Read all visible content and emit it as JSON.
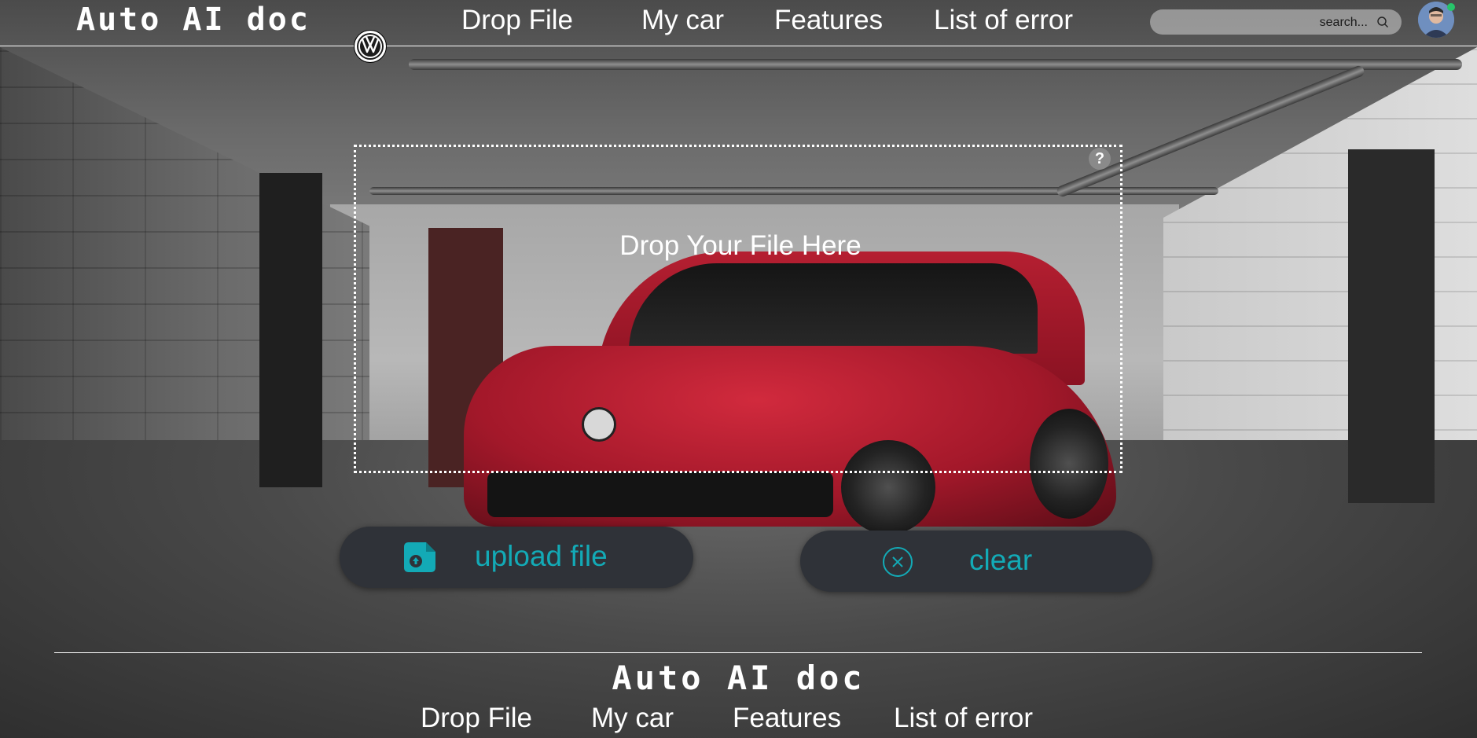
{
  "header": {
    "logo": "Auto AI doc",
    "nav": [
      "Drop File",
      "My car",
      "Features",
      "List of error"
    ],
    "search": {
      "placeholder": "search..."
    }
  },
  "dropzone": {
    "title": "Drop Your File Here",
    "help": "?"
  },
  "actions": {
    "upload_label": "upload file",
    "clear_label": "clear"
  },
  "footer": {
    "logo": "Auto AI doc",
    "nav": [
      "Drop File",
      "My car",
      "Features",
      "List of error"
    ]
  },
  "colors": {
    "accent": "#13aab6",
    "button_bg": "#2f3238",
    "text": "#ffffff"
  },
  "icons": [
    "vw-logo-icon",
    "search-icon",
    "help-icon",
    "upload-file-icon",
    "clear-x-icon",
    "avatar"
  ]
}
